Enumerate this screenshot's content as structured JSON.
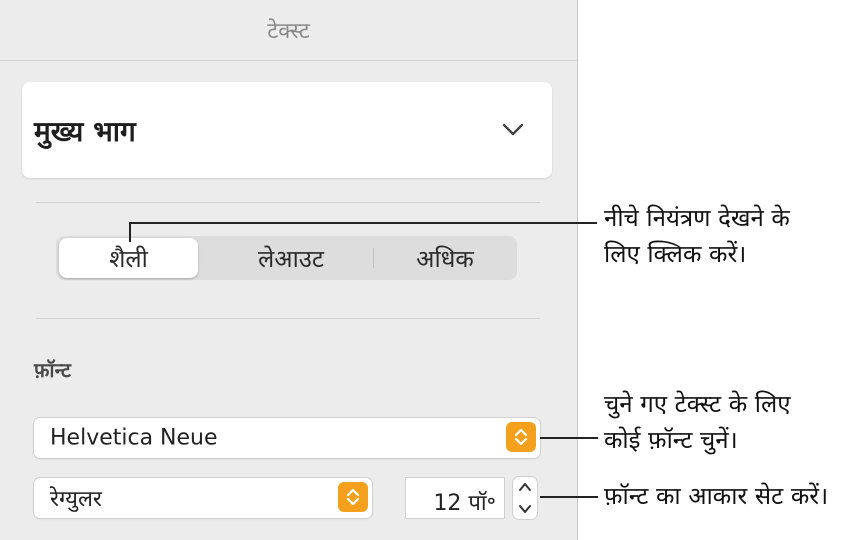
{
  "panel": {
    "title": "टेक्स्ट",
    "paragraph_style": "मुख्य भाग",
    "tabs": [
      "शैली",
      "लेआउट",
      "अधिक"
    ],
    "font_section_label": "फ़ॉन्ट",
    "font_family": "Helvetica Neue",
    "font_typeface": "रेग्युलर",
    "font_size": "12 पॉ॰"
  },
  "callouts": {
    "tab_line1": "नीचे नियंत्रण देखने के",
    "tab_line2": "लिए क्लिक करें।",
    "font_line1": "चुने गए टेक्स्ट के लिए",
    "font_line2": "कोई फ़ॉन्ट चुनें।",
    "size_line1": "फ़ॉन्ट का आकार सेट करें।"
  },
  "colors": {
    "accent": "#f4a01c",
    "panel_bg": "#ececec"
  },
  "icons": {
    "style_dropdown": "chevron-down-icon",
    "popup_arrows": "up-down-arrows-icon",
    "stepper": "stepper-icon"
  }
}
